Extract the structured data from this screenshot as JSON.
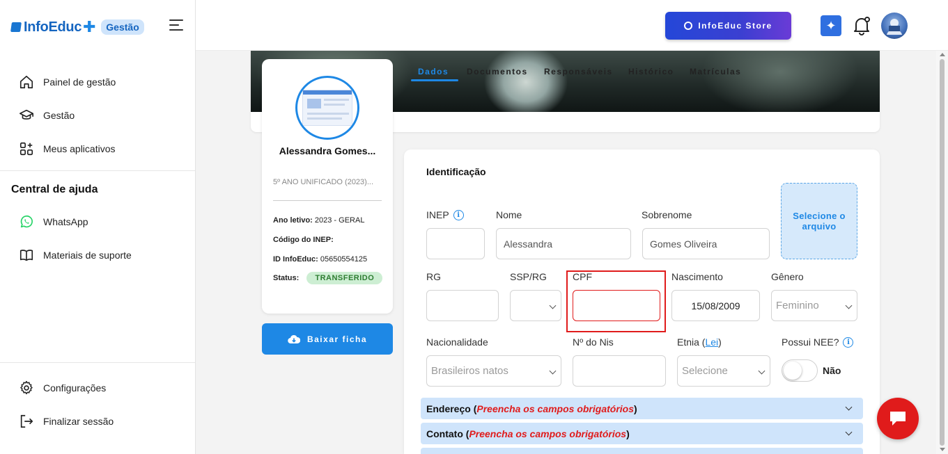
{
  "brand": {
    "name": "InfoEduc",
    "badge": "Gestão"
  },
  "sidebar": {
    "items": [
      {
        "label": "Painel de gestão",
        "icon": "home-icon"
      },
      {
        "label": "Gestão",
        "icon": "graduation-cap-icon"
      },
      {
        "label": "Meus aplicativos",
        "icon": "apps-icon"
      }
    ],
    "help_title": "Central de ajuda",
    "help_items": [
      {
        "label": "WhatsApp",
        "icon": "whatsapp-icon"
      },
      {
        "label": "Materiais de suporte",
        "icon": "book-icon"
      }
    ],
    "bottom_items": [
      {
        "label": "Configurações",
        "icon": "gear-icon"
      },
      {
        "label": "Finalizar sessão",
        "icon": "logout-icon"
      }
    ]
  },
  "header": {
    "store_label": "InfoEduc Store"
  },
  "tabs": [
    "Dados",
    "Documentos",
    "Responsáveis",
    "Histórico",
    "Matrículas"
  ],
  "profile": {
    "name": "Alessandra Gomes...",
    "class": "5º ANO UNIFICADO (2023)...",
    "ano_letivo_label": "Ano letivo:",
    "ano_letivo": "2023 - GERAL",
    "inep_label": "Código do INEP:",
    "inep": "",
    "id_label": "ID InfoEduc:",
    "id": "05650554125",
    "status_label": "Status:",
    "status": "TRANSFERIDO",
    "download_label": "Baixar ficha"
  },
  "form": {
    "section_title": "Identificação",
    "upload_label": "Selecione o arquivo",
    "fields": {
      "inep": {
        "label": "INEP",
        "value": ""
      },
      "nome": {
        "label": "Nome",
        "value": "Alessandra"
      },
      "sobrenome": {
        "label": "Sobrenome",
        "value": "Gomes Oliveira"
      },
      "rg": {
        "label": "RG",
        "value": ""
      },
      "ssp_rg": {
        "label": "SSP/RG",
        "value": ""
      },
      "cpf": {
        "label": "CPF",
        "value": ""
      },
      "nascimento": {
        "label": "Nascimento",
        "value": "15/08/2009"
      },
      "genero": {
        "label": "Gênero",
        "value": "Feminino"
      },
      "nacionalidade": {
        "label": "Nacionalidade",
        "value": "Brasileiros natos"
      },
      "nis": {
        "label": "Nº do Nis",
        "value": ""
      },
      "etnia": {
        "label": "Etnia",
        "link": "Lei",
        "value": "Selecione"
      },
      "nee": {
        "label": "Possui NEE?",
        "value": "Não"
      }
    }
  },
  "accordions": [
    {
      "title": "Endereço",
      "note": "Preencha os campos obrigatórios"
    },
    {
      "title": "Contato",
      "note": "Preencha os campos obrigatórios"
    }
  ],
  "colors": {
    "primary": "#1e88e5",
    "danger": "#e01b1b",
    "status_bg": "#cdeed3"
  }
}
